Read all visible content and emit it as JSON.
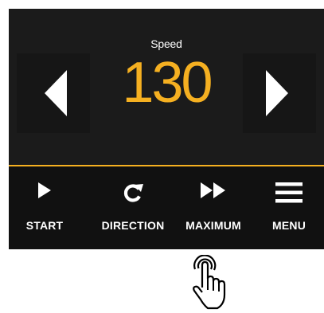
{
  "display": {
    "label": "Speed",
    "value": "130",
    "accent_color": "#f5b021",
    "left_icon": "triangle-left-icon",
    "right_icon": "triangle-right-icon"
  },
  "toolbar": {
    "items": [
      {
        "label": "START",
        "icon": "play-icon"
      },
      {
        "label": "DIRECTION",
        "icon": "rotate-icon"
      },
      {
        "label": "MAXIMUM",
        "icon": "fast-forward-icon"
      },
      {
        "label": "MENU",
        "icon": "hamburger-icon"
      }
    ]
  },
  "gesture": {
    "icon": "tap-hand-icon"
  }
}
